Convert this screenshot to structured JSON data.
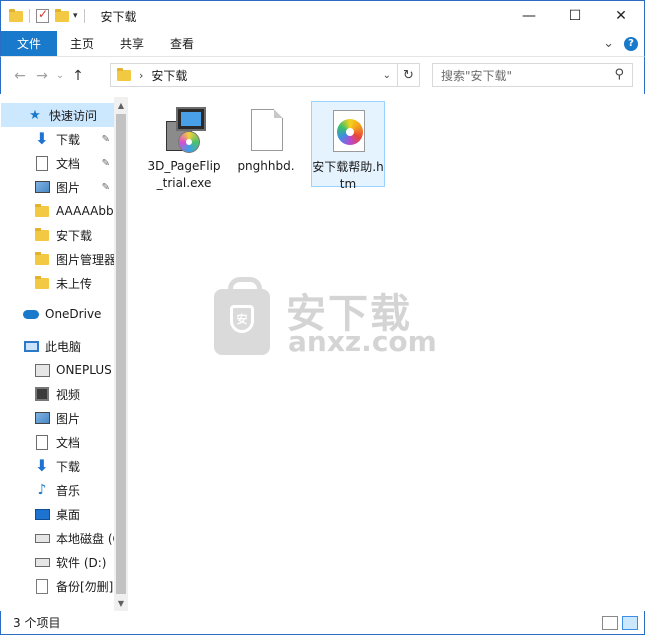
{
  "window": {
    "title": "安下载",
    "minimize_glyph": "—",
    "maximize_glyph": "☐",
    "close_glyph": "✕"
  },
  "ribbon": {
    "tabs": [
      "文件",
      "主页",
      "共享",
      "查看"
    ],
    "expand_glyph": "⌄",
    "help_glyph": "?"
  },
  "nav": {
    "back_glyph": "←",
    "forward_glyph": "→",
    "recent_glyph": "⌄",
    "up_glyph": "↑",
    "address_path": "安下载",
    "address_sep": "›",
    "refresh_glyph": "↻",
    "search_placeholder": "搜索\"安下载\"",
    "search_glyph": "⚲"
  },
  "sidebar": {
    "items": [
      {
        "label": "快速访问",
        "icon": "star-icon"
      },
      {
        "label": "下载",
        "icon": "download-arrow-icon",
        "pinned": true
      },
      {
        "label": "文档",
        "icon": "document-icon",
        "pinned": true
      },
      {
        "label": "图片",
        "icon": "picture-icon",
        "pinned": true
      },
      {
        "label": "AAAAAbbb",
        "icon": "folder-icon"
      },
      {
        "label": "安下载",
        "icon": "folder-icon"
      },
      {
        "label": "图片管理器",
        "icon": "folder-icon"
      },
      {
        "label": "未上传",
        "icon": "folder-icon"
      },
      {
        "label": "OneDrive",
        "icon": "cloud-icon"
      },
      {
        "label": "此电脑",
        "icon": "computer-icon"
      },
      {
        "label": "ONEPLUS",
        "icon": "phone-drive-icon"
      },
      {
        "label": "视频",
        "icon": "video-icon"
      },
      {
        "label": "图片",
        "icon": "picture-icon"
      },
      {
        "label": "文档",
        "icon": "document-icon"
      },
      {
        "label": "下载",
        "icon": "download-arrow-icon"
      },
      {
        "label": "音乐",
        "icon": "music-note-icon"
      },
      {
        "label": "桌面",
        "icon": "desktop-icon"
      },
      {
        "label": "本地磁盘 (C:)",
        "icon": "local-disk-icon"
      },
      {
        "label": "软件 (D:)",
        "icon": "drive-icon"
      },
      {
        "label": "备份[勿删]",
        "icon": "file-icon"
      }
    ],
    "pin_glyph": "📌",
    "scroll_up_glyph": "▲",
    "scroll_down_glyph": "▼"
  },
  "files": [
    {
      "name": "3D_PageFlip_trial.exe",
      "icon": "installer-exe-icon"
    },
    {
      "name": "pnghhbd.",
      "icon": "blank-file-icon"
    },
    {
      "name": "安下载帮助.htm",
      "icon": "htm-color-wheel-icon",
      "selected": true
    }
  ],
  "watermark": {
    "cn": "安下载",
    "en": "anxz.com",
    "badge": "安"
  },
  "status": {
    "count_text": "3 个项目"
  }
}
